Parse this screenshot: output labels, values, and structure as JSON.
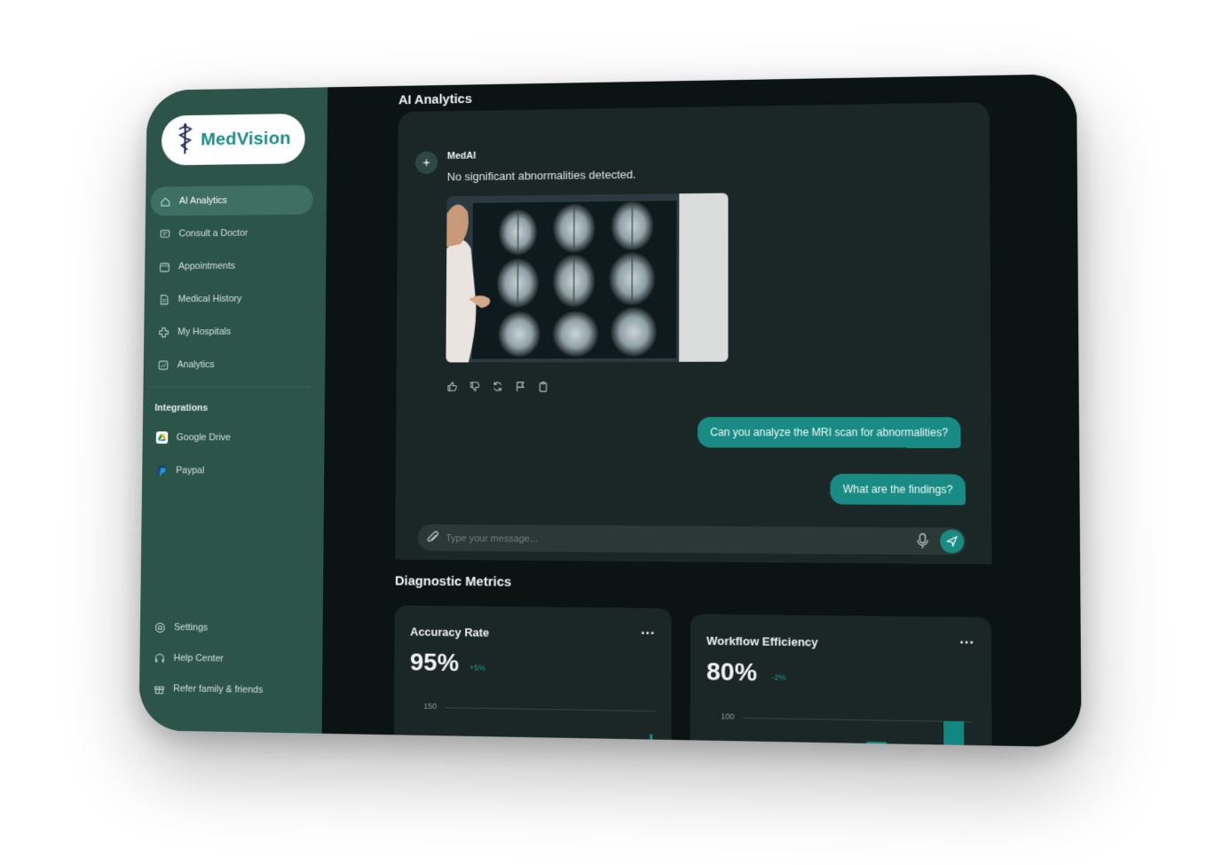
{
  "app": {
    "brand": "MedVision",
    "brand_icon": "caduceus-icon"
  },
  "sidebar": {
    "items": [
      {
        "label": "AI Analytics",
        "icon": "home-icon",
        "active": true
      },
      {
        "label": "Consult a Doctor",
        "icon": "chat-icon"
      },
      {
        "label": "Appointments",
        "icon": "calendar-icon"
      },
      {
        "label": "Medical History",
        "icon": "document-icon"
      },
      {
        "label": "My Hospitals",
        "icon": "medical-cross-icon"
      },
      {
        "label": "Analytics",
        "icon": "chart-icon"
      }
    ],
    "integrations_label": "Integrations",
    "integrations": [
      {
        "label": "Google Drive",
        "icon": "google-drive-icon"
      },
      {
        "label": "Paypal",
        "icon": "paypal-icon"
      }
    ],
    "bottom": [
      {
        "label": "Settings",
        "icon": "gear-icon"
      },
      {
        "label": "Help Center",
        "icon": "headset-icon"
      },
      {
        "label": "Refer family & friends",
        "icon": "gift-icon"
      }
    ]
  },
  "main": {
    "title": "AI Analytics",
    "chat": {
      "bot_name": "MedAI",
      "bot_message": "No significant abnormalities detected.",
      "image_alt": "MRI brain scans on lightbox",
      "user_messages": [
        "Can you analyze the MRI scan for abnormalities?",
        "What are the findings?"
      ],
      "input_placeholder": "Type your message..."
    },
    "metrics_title": "Diagnostic Metrics",
    "metrics": [
      {
        "title": "Accuracy Rate",
        "value": "95%",
        "delta": "+5%",
        "axis_top": "150",
        "more": "..."
      },
      {
        "title": "Workflow Efficiency",
        "value": "80%",
        "delta": "-2%",
        "axis_top": "100",
        "more": "..."
      }
    ]
  },
  "colors": {
    "sidebar_bg": "#2c5449",
    "accent": "#1a8b84",
    "main_bg": "#0b1413",
    "card_bg": "#1b2726"
  }
}
